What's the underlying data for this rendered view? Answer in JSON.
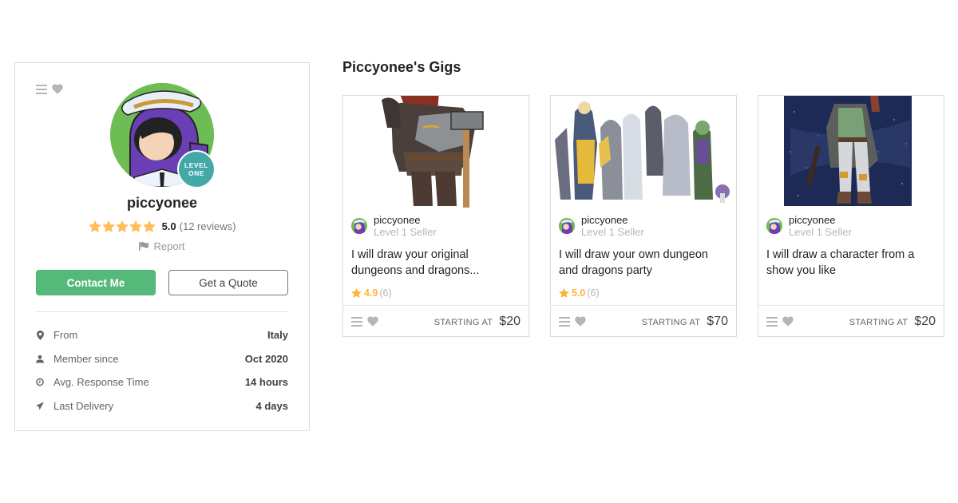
{
  "profile": {
    "username": "piccyonee",
    "level_badge": {
      "line1": "LEVEL",
      "line2": "ONE"
    },
    "rating": {
      "stars": 5,
      "max_stars": 5,
      "score": "5.0",
      "reviews": "(12 reviews)"
    },
    "report_label": "Report",
    "contact_button": "Contact Me",
    "quote_button": "Get a Quote",
    "stats": [
      {
        "icon": "location-pin-icon",
        "label": "From",
        "value": "Italy"
      },
      {
        "icon": "user-icon",
        "label": "Member since",
        "value": "Oct 2020"
      },
      {
        "icon": "clock-icon",
        "label": "Avg. Response Time",
        "value": "14 hours"
      },
      {
        "icon": "paper-plane-icon",
        "label": "Last Delivery",
        "value": "4 days"
      }
    ]
  },
  "gigs_section": {
    "title": "Piccyonee's Gigs",
    "gigs": [
      {
        "image": "dwarf-warrior-illustration",
        "seller_name": "piccyonee",
        "seller_level": "Level 1 Seller",
        "title": "I will draw your original dungeons and dragons...",
        "rating_score": "4.9",
        "rating_count": "(6)",
        "starting_label": "STARTING AT",
        "price": "$20"
      },
      {
        "image": "dnd-party-illustration",
        "seller_name": "piccyonee",
        "seller_level": "Level 1 Seller",
        "title": "I will draw your own dungeon and dragons party",
        "rating_score": "5.0",
        "rating_count": "(6)",
        "starting_label": "STARTING AT",
        "price": "$70"
      },
      {
        "image": "bounty-hunter-space-illustration",
        "seller_name": "piccyonee",
        "seller_level": "Level 1 Seller",
        "title": "I will draw a character from a show you like",
        "rating_score": null,
        "rating_count": null,
        "starting_label": "STARTING AT",
        "price": "$20"
      }
    ]
  },
  "colors": {
    "primary_green": "#55b97a",
    "star_gold": "#ffb33e",
    "level_badge_teal": "#43a8a8",
    "border": "#dadbdd"
  }
}
